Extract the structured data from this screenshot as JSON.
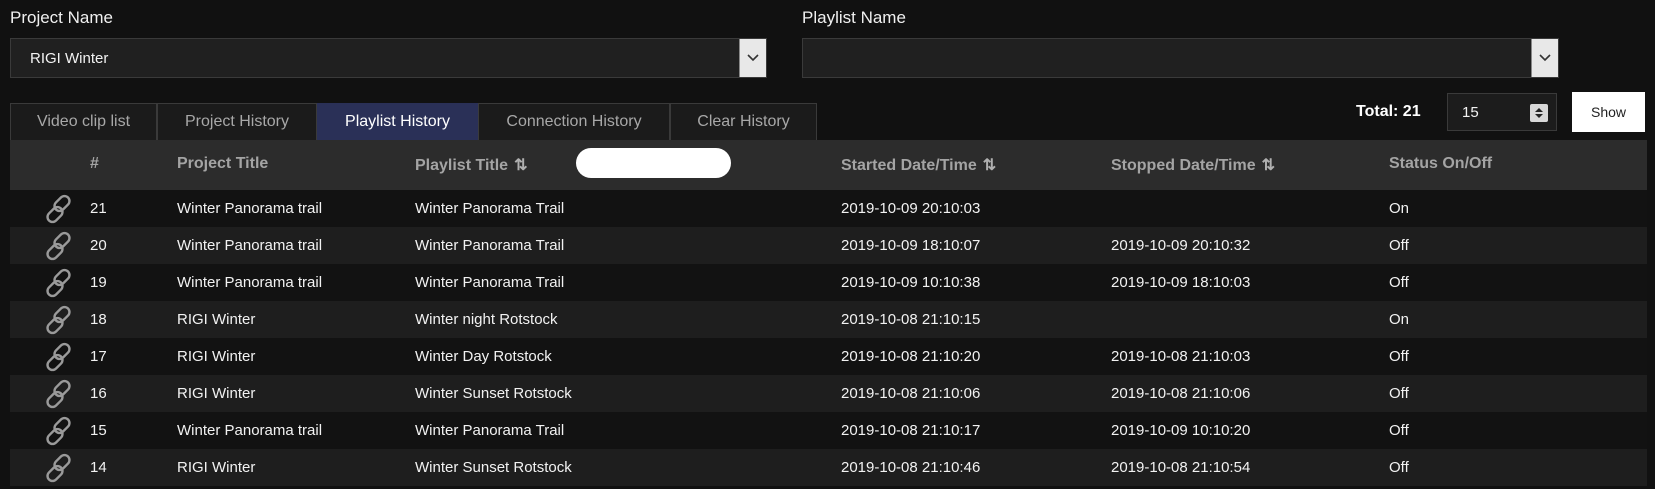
{
  "project": {
    "label": "Project Name",
    "selected": "RIGI Winter"
  },
  "playlist": {
    "label": "Playlist Name",
    "selected": ""
  },
  "tabs": [
    {
      "label": "Video clip list"
    },
    {
      "label": "Project History"
    },
    {
      "label": "Playlist History"
    },
    {
      "label": "Connection History"
    },
    {
      "label": "Clear History"
    }
  ],
  "active_tab": "Playlist History",
  "total_label": "Total: 21",
  "page_size": "15",
  "show_label": "Show",
  "table": {
    "headers": {
      "num": "#",
      "project": "Project Title",
      "playlist": "Playlist Title",
      "started": "Started Date/Time",
      "stopped": "Stopped Date/Time",
      "status": "Status On/Off"
    },
    "rows": [
      {
        "num": "21",
        "project": "Winter Panorama trail",
        "playlist": "Winter Panorama Trail",
        "started": "2019-10-09 20:10:03",
        "stopped": "",
        "status": "On"
      },
      {
        "num": "20",
        "project": "Winter Panorama trail",
        "playlist": "Winter Panorama Trail",
        "started": "2019-10-09 18:10:07",
        "stopped": "2019-10-09 20:10:32",
        "status": "Off"
      },
      {
        "num": "19",
        "project": "Winter Panorama trail",
        "playlist": "Winter Panorama Trail",
        "started": "2019-10-09 10:10:38",
        "stopped": "2019-10-09 18:10:03",
        "status": "Off"
      },
      {
        "num": "18",
        "project": "RIGI Winter",
        "playlist": "Winter night Rotstock",
        "started": "2019-10-08 21:10:15",
        "stopped": "",
        "status": "On"
      },
      {
        "num": "17",
        "project": "RIGI Winter",
        "playlist": "Winter Day Rotstock",
        "started": "2019-10-08 21:10:20",
        "stopped": "2019-10-08 21:10:03",
        "status": "Off"
      },
      {
        "num": "16",
        "project": "RIGI Winter",
        "playlist": "Winter Sunset Rotstock",
        "started": "2019-10-08 21:10:06",
        "stopped": "2019-10-08 21:10:06",
        "status": "Off"
      },
      {
        "num": "15",
        "project": "Winter Panorama trail",
        "playlist": "Winter Panorama Trail",
        "started": "2019-10-08 21:10:17",
        "stopped": "2019-10-09 10:10:20",
        "status": "Off"
      },
      {
        "num": "14",
        "project": "RIGI Winter",
        "playlist": "Winter Sunset Rotstock",
        "started": "2019-10-08 21:10:46",
        "stopped": "2019-10-08 21:10:54",
        "status": "Off"
      }
    ]
  }
}
